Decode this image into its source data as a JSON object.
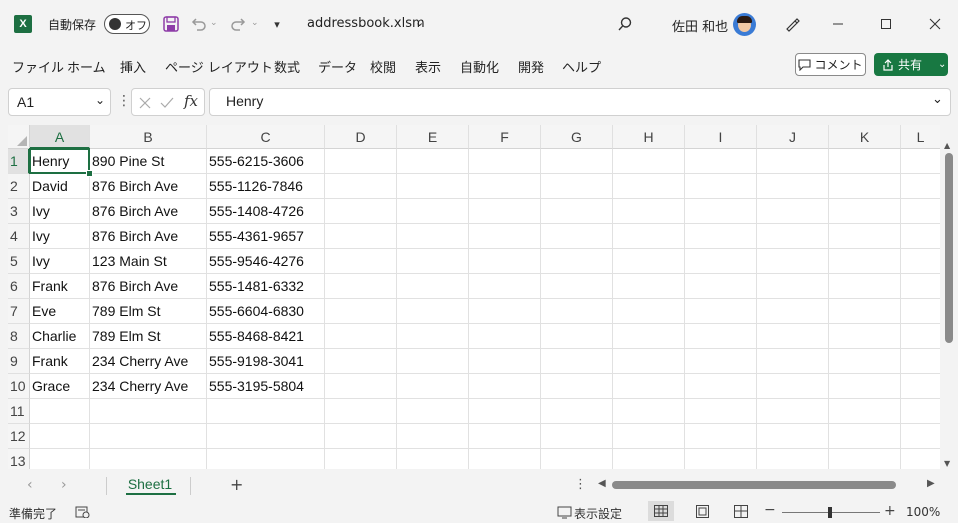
{
  "titlebar": {
    "autosave_label": "自動保存",
    "autosave_state": "オフ",
    "filename": "addressbook.xlsm",
    "username": "佐田 和也"
  },
  "menu": [
    "ファイル",
    "ホーム",
    "挿入",
    "ページ レイアウト",
    "数式",
    "データ",
    "校閲",
    "表示",
    "自動化",
    "開発",
    "ヘルプ"
  ],
  "buttons": {
    "comment": "コメント",
    "share": "共有"
  },
  "formula_bar": {
    "name_box": "A1",
    "fx": "fx",
    "content": "Henry"
  },
  "columns": [
    "A",
    "B",
    "C",
    "D",
    "E",
    "F",
    "G",
    "H",
    "I",
    "J",
    "K",
    "L"
  ],
  "rows": [
    "1",
    "2",
    "3",
    "4",
    "5",
    "6",
    "7",
    "8",
    "9",
    "10",
    "11",
    "12",
    "13"
  ],
  "cells": [
    [
      "Henry",
      "890 Pine St",
      "555-6215-3606"
    ],
    [
      "David",
      "876 Birch Ave",
      "555-1126-7846"
    ],
    [
      "Ivy",
      "876 Birch Ave",
      "555-1408-4726"
    ],
    [
      "Ivy",
      "876 Birch Ave",
      "555-4361-9657"
    ],
    [
      "Ivy",
      "123 Main St",
      "555-9546-4276"
    ],
    [
      "Frank",
      "876 Birch Ave",
      "555-1481-6332"
    ],
    [
      "Eve",
      "789 Elm St",
      "555-6604-6830"
    ],
    [
      "Charlie",
      "789 Elm St",
      "555-8468-8421"
    ],
    [
      "Frank",
      "234 Cherry Ave",
      "555-9198-3041"
    ],
    [
      "Grace",
      "234 Cherry Ave",
      "555-3195-5804"
    ]
  ],
  "sheets": [
    "Sheet1"
  ],
  "status": {
    "ready": "準備完了",
    "display_settings": "表示設定",
    "zoom": "100%"
  },
  "accent_color": "#1d6f42"
}
